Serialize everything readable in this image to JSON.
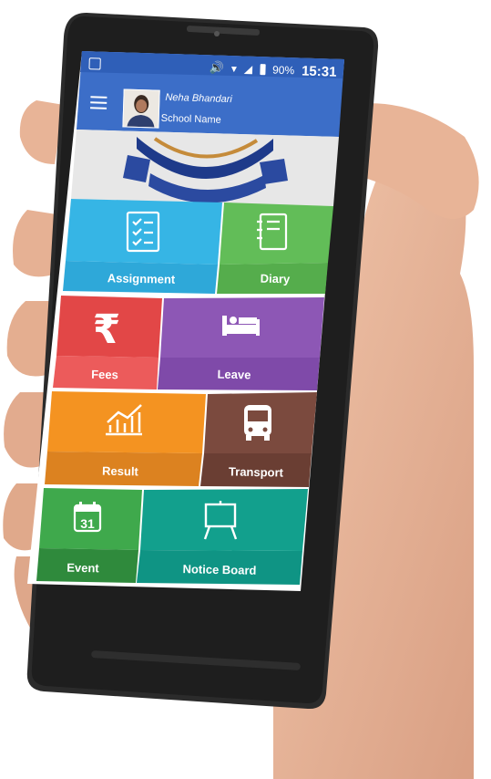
{
  "status_bar": {
    "battery": "90%",
    "time": "15:31"
  },
  "user": {
    "name": "Neha Bhandari",
    "school": "School Name"
  },
  "tiles": [
    {
      "label": "Assignment",
      "icon": "checklist-icon",
      "color": "#36b5e5",
      "label_color": "#2ea8d9"
    },
    {
      "label": "Diary",
      "icon": "notebook-icon",
      "color": "#62bd58",
      "label_color": "#55ad4c"
    },
    {
      "label": "Fees",
      "icon": "rupee-icon",
      "color": "#e24747",
      "label_color": "#ec5b5b"
    },
    {
      "label": "Leave",
      "icon": "bed-icon",
      "color": "#8d57b5",
      "label_color": "#7f4aa9"
    },
    {
      "label": "Result",
      "icon": "bar-chart-icon",
      "color": "#f49321",
      "label_color": "#dc8220"
    },
    {
      "label": "Transport",
      "icon": "bus-icon",
      "color": "#7b4a3e",
      "label_color": "#6a3e33"
    },
    {
      "label": "Event",
      "icon": "calendar-icon",
      "color": "#3fa94c",
      "label_color": "#2f8a3c",
      "icon_text": "31"
    },
    {
      "label": "Notice Board",
      "icon": "easel-icon",
      "color": "#12a08d",
      "label_color": "#0f9484"
    }
  ],
  "colors": {
    "appbar": "#3c6ec8",
    "statusbar": "#2f5fb8",
    "phone": "#2a2a2a",
    "skin": "#e9b99d"
  }
}
